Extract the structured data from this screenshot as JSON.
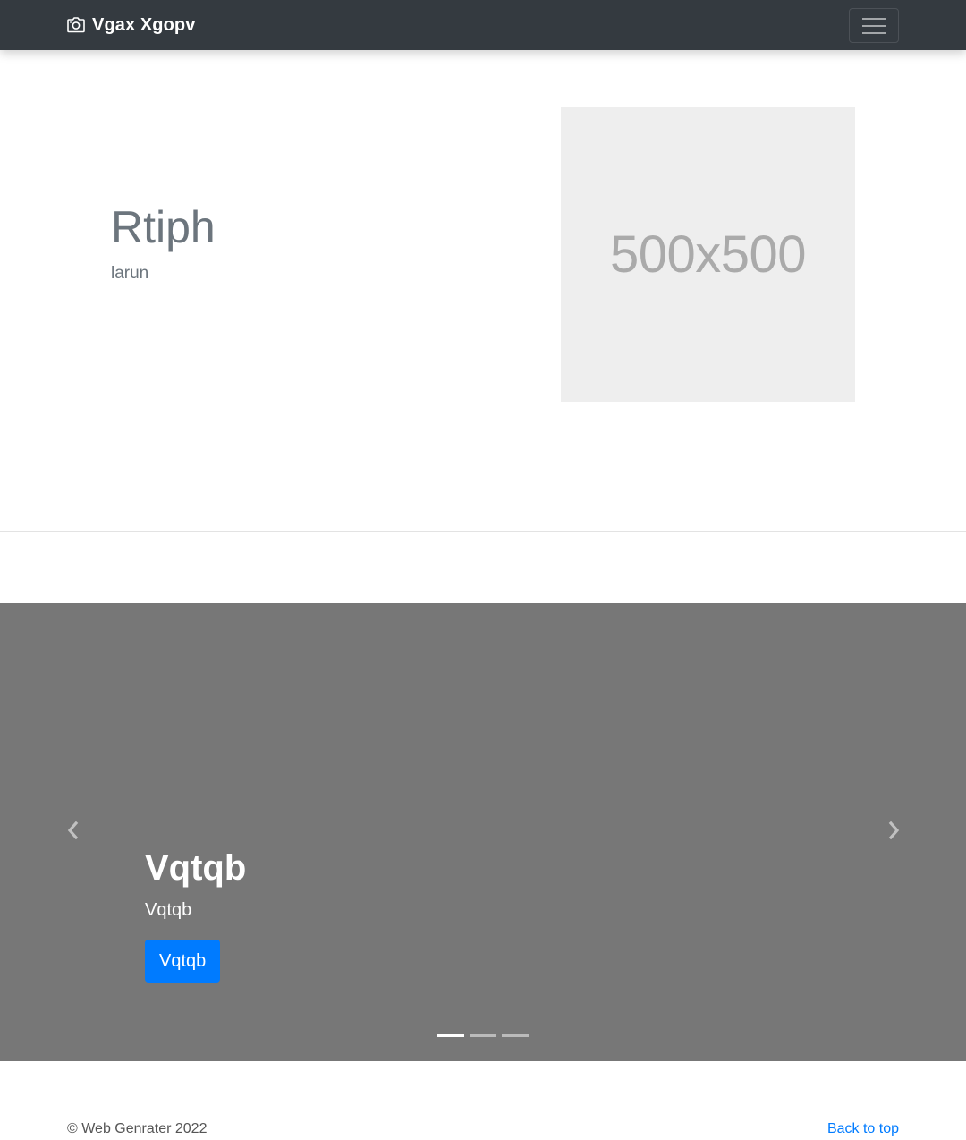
{
  "navbar": {
    "brand_text": "Vgax Xgopv",
    "brand_icon": "camera-icon",
    "toggler_icon": "hamburger-menu-icon"
  },
  "hero": {
    "title": "Rtiph",
    "subtitle": "larun",
    "image_placeholder": "500x500"
  },
  "carousel": {
    "caption_title": "Vqtqb",
    "caption_text": "Vqtqb",
    "button_label": "Vqtqb",
    "prev_icon": "chevron-left-icon",
    "next_icon": "chevron-right-icon",
    "slide_count": 3,
    "active_slide": 1
  },
  "footer": {
    "copyright": "© Web Genrater 2022",
    "back_to_top": "Back to top"
  },
  "colors": {
    "navbar_bg": "#343a40",
    "carousel_bg": "#777777",
    "primary": "#007bff",
    "muted_text": "#6c757d",
    "placeholder_bg": "#eeeeee"
  }
}
